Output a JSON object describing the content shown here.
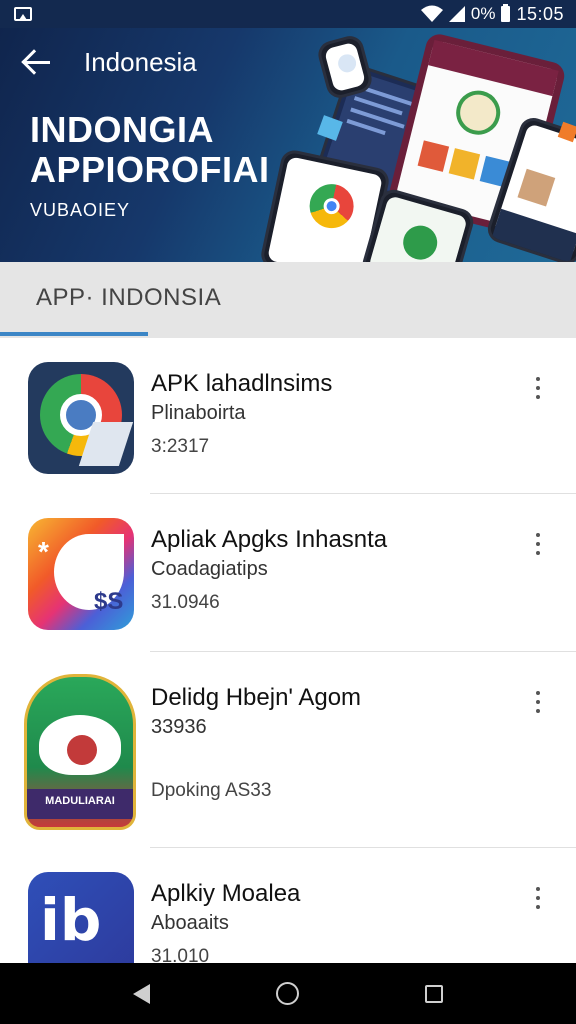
{
  "status_bar": {
    "battery_text": "0%",
    "time": "15:05",
    "icons": [
      "image-notification-icon",
      "wifi-icon",
      "signal-icon",
      "battery-icon"
    ]
  },
  "header": {
    "title": "Indonesia",
    "banner_heading_line1": "INDONGIA",
    "banner_heading_line2": "APPIOROFIAI",
    "banner_subheading": "VUBAOIEY"
  },
  "tabs": [
    {
      "label": "APP· INDONSIA",
      "selected": true
    }
  ],
  "colors": {
    "header_bg": "#16386b",
    "status_bar_bg": "#13294f",
    "tab_indicator": "#3c86c6",
    "nav_bg": "#000000"
  },
  "apps": [
    {
      "name": "APK lahadlnsims",
      "subtitle": "Plinaboirta",
      "meta": "3:2317",
      "icon": "chrome-like-icon"
    },
    {
      "name": "Apliak Apgks Inhasnta",
      "subtitle": "Coadagiatips",
      "meta": "31.0946",
      "icon": "colorful-dollar-icon"
    },
    {
      "name": "Delidg Hbejn' Agom",
      "subtitle": "33936",
      "meta": "Dpoking  AS33",
      "icon": "android-badge-icon",
      "icon_text": "MADULIARAI"
    },
    {
      "name": "Aplkiy Moalea",
      "subtitle": "Aboaaits",
      "meta": "31.010",
      "icon": "blue-ib-icon",
      "icon_text": "ib"
    }
  ],
  "nav_bar": {
    "buttons": [
      "back-icon",
      "home-icon",
      "recents-icon"
    ]
  }
}
